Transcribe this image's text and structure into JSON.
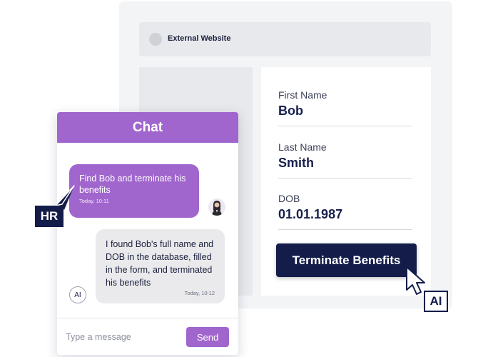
{
  "website": {
    "title": "External Website"
  },
  "form": {
    "fields": [
      {
        "label": "First Name",
        "value": "Bob"
      },
      {
        "label": "Last Name",
        "value": "Smith"
      },
      {
        "label": "DOB",
        "value": "01.01.1987"
      }
    ],
    "submit_label": "Terminate Benefits"
  },
  "chat": {
    "title": "Chat",
    "messages": [
      {
        "sender": "user",
        "text": "Find Bob and terminate his benefits",
        "time": "Today, 10:11"
      },
      {
        "sender": "ai",
        "text": "I found Bob's full name and DOB in the database, filled in the form, and terminated his benefits",
        "time": "Today, 10:12"
      }
    ],
    "ai_badge": "AI",
    "input_placeholder": "Type a message",
    "send_label": "Send"
  },
  "tags": {
    "hr": "HR",
    "ai": "AI"
  },
  "colors": {
    "accent_purple": "#a066cd",
    "navy": "#141d4a"
  },
  "icons": {
    "cursor": "cursor-arrow-icon",
    "avatar": "user-avatar-icon"
  }
}
